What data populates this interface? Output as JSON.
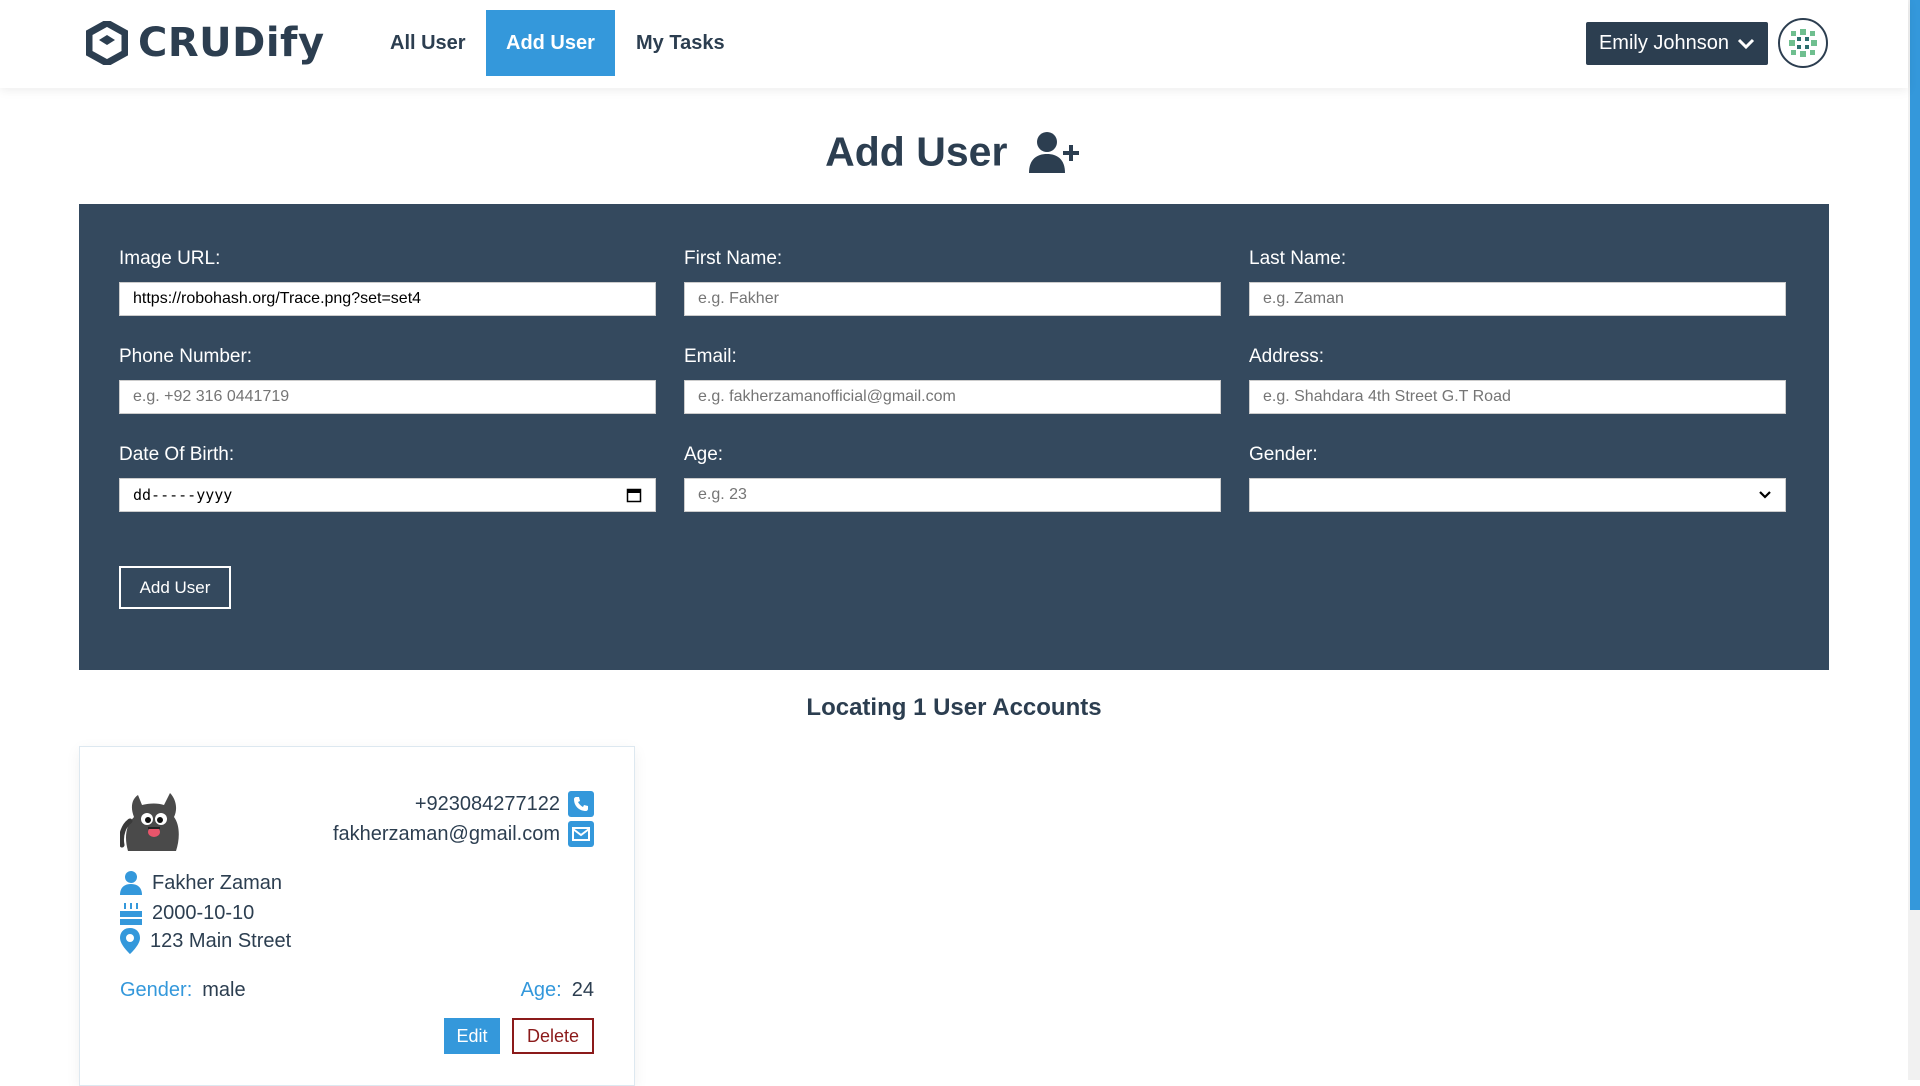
{
  "nav": {
    "brand": "CRUDify",
    "links": [
      "All User",
      "Add User",
      "My Tasks"
    ],
    "active_link": "Add User",
    "user_name": "Emily Johnson"
  },
  "page": {
    "title": "Add User"
  },
  "form": {
    "fields": {
      "image_url": {
        "label": "Image URL:",
        "value": "https://robohash.org/Trace.png?set=set4",
        "placeholder": ""
      },
      "first_name": {
        "label": "First Name:",
        "placeholder": "e.g. Fakher"
      },
      "last_name": {
        "label": "Last Name:",
        "placeholder": "e.g. Zaman"
      },
      "phone": {
        "label": "Phone Number:",
        "placeholder": "e.g. +92 316 0441719"
      },
      "email": {
        "label": "Email:",
        "placeholder": "e.g. fakherzamanofficial@gmail.com"
      },
      "address": {
        "label": "Address:",
        "placeholder": "e.g. Shahdara 4th Street G.T Road"
      },
      "dob": {
        "label": "Date Of Birth:",
        "display": "dd-----yyyy"
      },
      "age": {
        "label": "Age:",
        "placeholder": "e.g. 23"
      },
      "gender": {
        "label": "Gender:",
        "selected": ""
      }
    },
    "submit_label": "Add User"
  },
  "results": {
    "title": "Locating 1 User Accounts"
  },
  "users": [
    {
      "phone": "+923084277122",
      "email": "fakherzaman@gmail.com",
      "name": "Fakher Zaman",
      "dob": "2000-10-10",
      "address": "123 Main Street",
      "gender_label": "Gender:",
      "gender": "male",
      "age_label": "Age:",
      "age": "24",
      "edit_label": "Edit",
      "delete_label": "Delete"
    }
  ],
  "colors": {
    "primary": "#3498db",
    "dark": "#2c3e50",
    "panel": "#34495e",
    "danger": "#8b1a1a"
  },
  "icons": [
    "logo-hexagon-icon",
    "chevron-down-icon",
    "user-avatar-icon",
    "add-user-icon",
    "calendar-icon",
    "select-chevron-icon",
    "cat-avatar-icon",
    "phone-icon",
    "envelope-icon",
    "user-icon",
    "birthday-cake-icon",
    "map-pin-icon"
  ]
}
